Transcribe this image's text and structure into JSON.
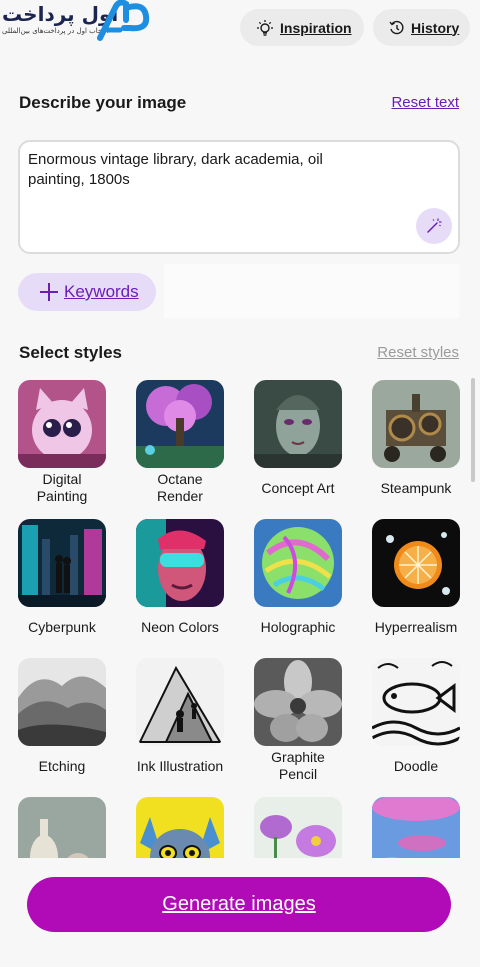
{
  "logo": {
    "text": "اول پرداخت",
    "subtitle": "انتخاب اول در پرداخت‌های بین‌المللی"
  },
  "header": {
    "inspiration_label": "Inspiration",
    "history_label": "History"
  },
  "describe": {
    "title": "Describe your image",
    "reset_label": "Reset text",
    "prompt_value": "Enormous vintage library, dark academia, oil painting, 1800s"
  },
  "keywords": {
    "label": "Keywords"
  },
  "styles": {
    "title": "Select styles",
    "reset_label": "Reset styles",
    "items": [
      {
        "label": "Digital Painting"
      },
      {
        "label": "Octane Render"
      },
      {
        "label": "Concept Art"
      },
      {
        "label": "Steampunk"
      },
      {
        "label": "Cyberpunk"
      },
      {
        "label": "Neon Colors"
      },
      {
        "label": "Holographic"
      },
      {
        "label": "Hyperrealism"
      },
      {
        "label": "Etching"
      },
      {
        "label": "Ink Illustration"
      },
      {
        "label": "Graphite Pencil"
      },
      {
        "label": "Doodle"
      },
      {
        "label": ""
      },
      {
        "label": ""
      },
      {
        "label": ""
      },
      {
        "label": ""
      }
    ]
  },
  "footer": {
    "generate_label": "Generate images"
  },
  "colors": {
    "accent": "#6a1fb4",
    "accent_light": "#e7dcf7",
    "generate": "#b00bb6"
  }
}
